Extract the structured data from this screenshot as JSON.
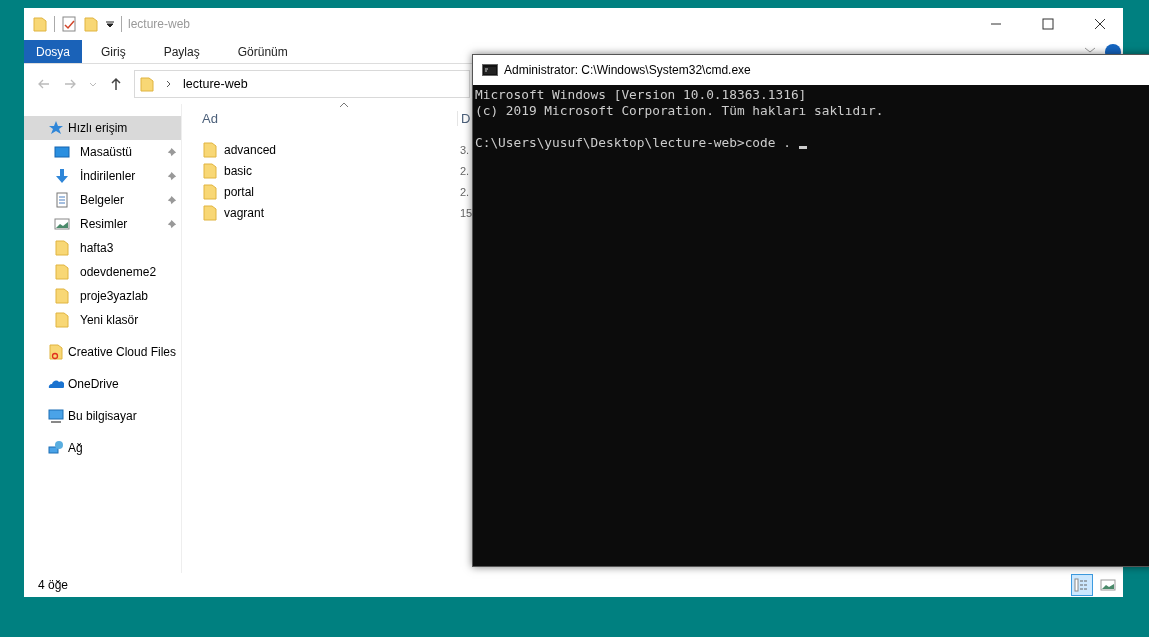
{
  "explorer": {
    "title": "lecture-web",
    "ribbon_tabs": [
      {
        "label": "Dosya",
        "selected": true
      },
      {
        "label": "Giriş",
        "selected": false
      },
      {
        "label": "Paylaş",
        "selected": false
      },
      {
        "label": "Görünüm",
        "selected": false
      }
    ],
    "address": "lecture-web",
    "sidebar": [
      {
        "label": "Hızlı erişim",
        "kind": "star",
        "selected": true,
        "children": [
          {
            "label": "Masaüstü",
            "kind": "desktop",
            "selected": false,
            "pinned": true
          },
          {
            "label": "İndirilenler",
            "kind": "download",
            "selected": false,
            "pinned": true
          },
          {
            "label": "Belgeler",
            "kind": "document",
            "selected": false,
            "pinned": true
          },
          {
            "label": "Resimler",
            "kind": "pictures",
            "selected": false,
            "pinned": true
          },
          {
            "label": "hafta3",
            "kind": "folder",
            "selected": false,
            "pinned": false
          },
          {
            "label": "odevdeneme2",
            "kind": "folder",
            "selected": false,
            "pinned": false
          },
          {
            "label": "proje3yazlab",
            "kind": "folder",
            "selected": false,
            "pinned": false
          },
          {
            "label": "Yeni klasör",
            "kind": "folder",
            "selected": false,
            "pinned": false
          }
        ]
      },
      {
        "label": "Creative Cloud Files",
        "kind": "cloud-folder",
        "selected": false
      },
      {
        "label": "OneDrive",
        "kind": "onedrive",
        "selected": false
      },
      {
        "label": "Bu bilgisayar",
        "kind": "computer",
        "selected": false
      },
      {
        "label": "Ağ",
        "kind": "network",
        "selected": false
      }
    ],
    "columns": [
      "Ad",
      "D"
    ],
    "files": [
      {
        "name": "advanced",
        "column_2": "3."
      },
      {
        "name": "basic",
        "column_2": "2."
      },
      {
        "name": "portal",
        "column_2": "2."
      },
      {
        "name": "vagrant",
        "column_2": "15"
      }
    ],
    "status_bar": "4 öğe",
    "view_buttons": [
      {
        "kind": "details",
        "selected": true
      },
      {
        "kind": "large-icons",
        "selected": false
      }
    ]
  },
  "cmd": {
    "title": "Administrator: C:\\Windows\\System32\\cmd.exe",
    "lines": [
      {
        "kind": "output",
        "text": "Microsoft Windows [Version 10.0.18363.1316]"
      },
      {
        "kind": "output",
        "text": "(c) 2019 Microsoft Corporation. Tüm hakları saklıdır."
      },
      {
        "kind": "prompt",
        "text": "C:\\Users\\yusuf\\Desktop\\lecture-web>code . "
      }
    ]
  }
}
